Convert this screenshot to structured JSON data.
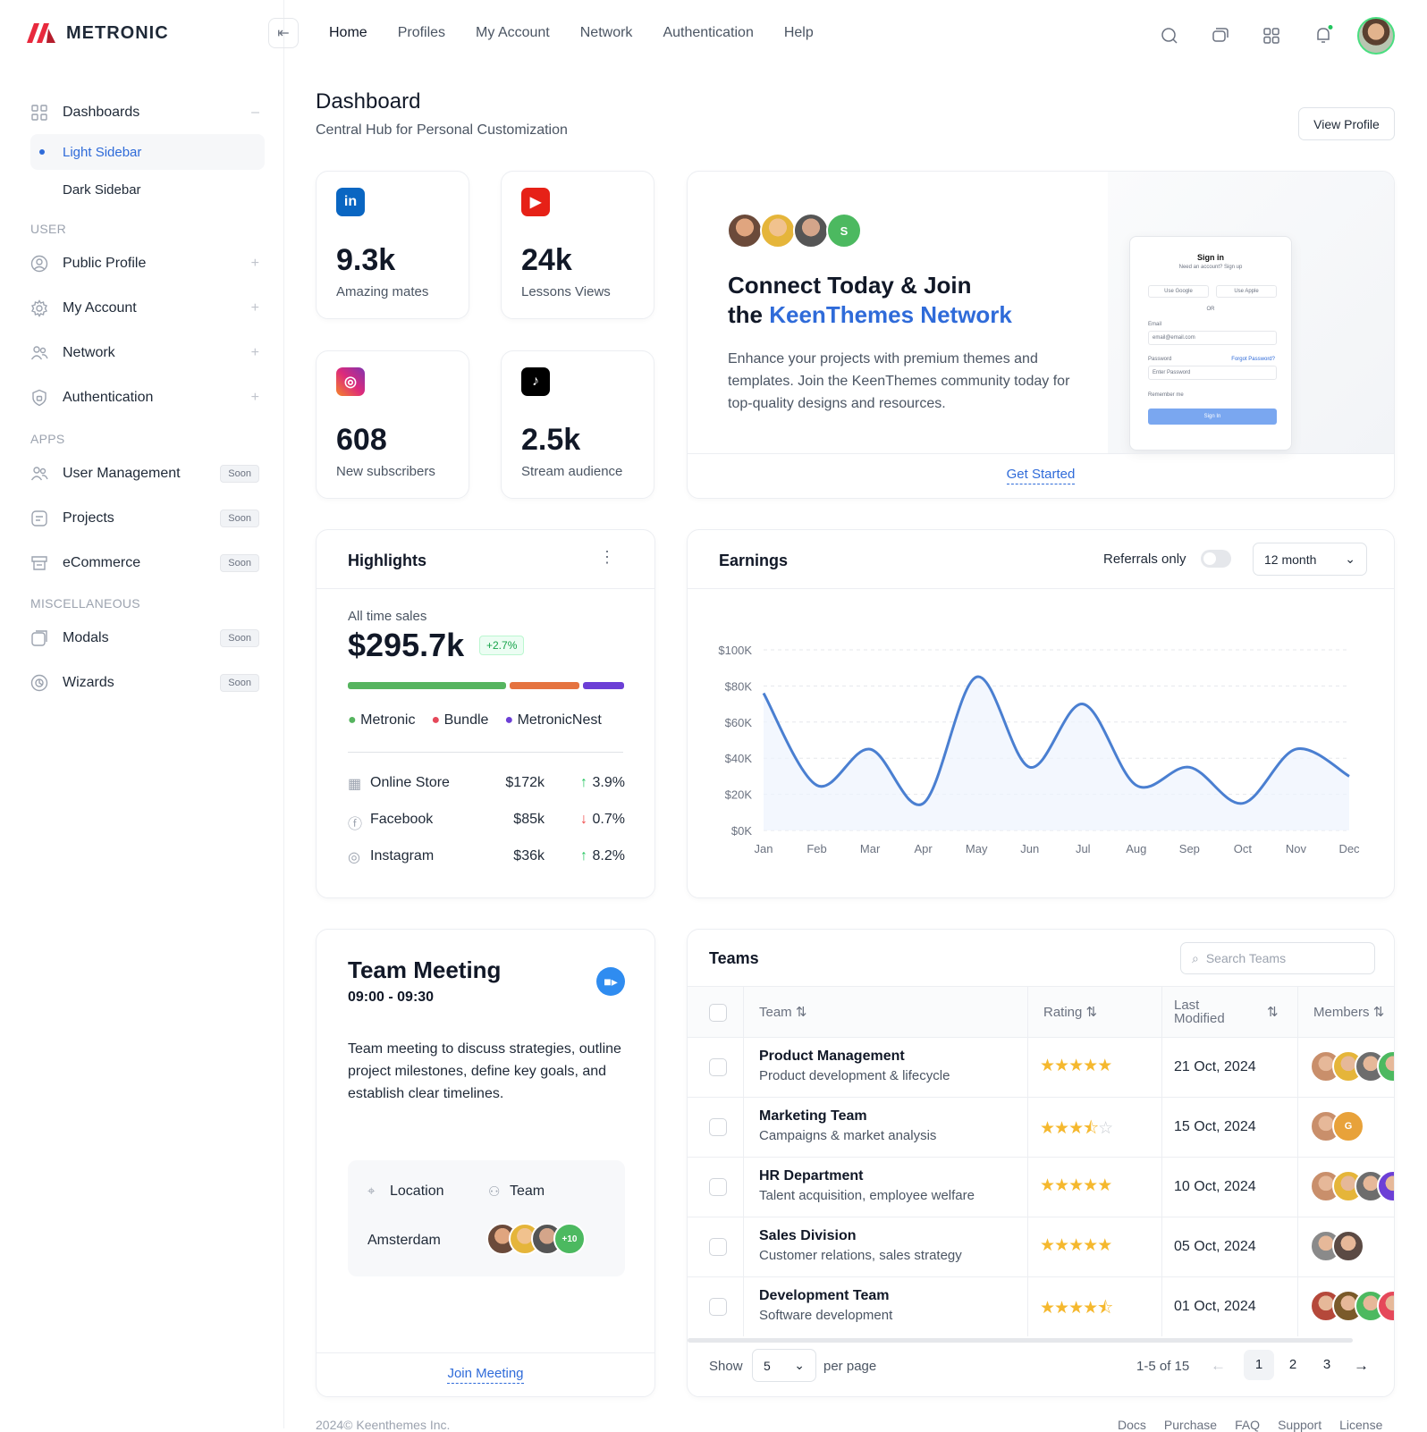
{
  "app": {
    "name": "METRONIC"
  },
  "topnav": [
    "Home",
    "Profiles",
    "My Account",
    "Network",
    "Authentication",
    "Help"
  ],
  "sidebar": {
    "dashboards": "Dashboards",
    "light_sidebar": "Light Sidebar",
    "dark_sidebar": "Dark Sidebar",
    "user_heading": "USER",
    "public_profile": "Public Profile",
    "my_account": "My Account",
    "network": "Network",
    "authentication": "Authentication",
    "apps_heading": "APPS",
    "user_management": "User Management",
    "projects": "Projects",
    "ecommerce": "eCommerce",
    "misc_heading": "MISCELLANEOUS",
    "modals": "Modals",
    "wizards": "Wizards",
    "soon": "Soon",
    "plus": "+",
    "minus": "–"
  },
  "header": {
    "title": "Dashboard",
    "subtitle": "Central Hub for Personal Customization",
    "view_profile": "View Profile"
  },
  "stats": [
    {
      "value": "9.3k",
      "label": "Amazing mates",
      "icon": "linkedin-icon",
      "color": "#0a66c2"
    },
    {
      "value": "24k",
      "label": "Lessons Views",
      "icon": "youtube-icon",
      "color": "#e62117"
    },
    {
      "value": "608",
      "label": "New subscribers",
      "icon": "instagram-icon",
      "color": "#c13584"
    },
    {
      "value": "2.5k",
      "label": "Stream audience",
      "icon": "tiktok-icon",
      "color": "#000000"
    }
  ],
  "connect": {
    "line1": "Connect Today & Join",
    "line2_prefix": "the",
    "line2_brand": "KeenThemes Network",
    "body": "Enhance your projects with premium themes and templates. Join the KeenThemes community today for top-quality designs and resources.",
    "cta": "Get Started",
    "avatar_letter": "S",
    "mock": {
      "title": "Sign in",
      "subtitle": "Need an account? Sign up",
      "google": "Use Google",
      "apple": "Use Apple",
      "or": "OR",
      "email": "Email",
      "email_ph": "email@email.com",
      "password": "Password",
      "forgot": "Forgot Password?",
      "password_ph": "Enter Password",
      "remember": "Remember me",
      "signin": "Sign In"
    }
  },
  "highlights": {
    "title": "Highlights",
    "all_time": "All time sales",
    "amount": "$295.7k",
    "badge": "+2.7%",
    "legend": [
      {
        "name": "Metronic",
        "color": "#56b45f"
      },
      {
        "name": "Bundle",
        "color": "#e57340"
      },
      {
        "name": "MetronicNest",
        "color": "#6c3fd6"
      }
    ],
    "rows": [
      {
        "name": "Online Store",
        "value": "$172k",
        "change": "3.9%",
        "dir": "up"
      },
      {
        "name": "Facebook",
        "value": "$85k",
        "change": "0.7%",
        "dir": "down"
      },
      {
        "name": "Instagram",
        "value": "$36k",
        "change": "8.2%",
        "dir": "up"
      }
    ]
  },
  "earnings": {
    "title": "Earnings",
    "referrals": "Referrals only",
    "period": "12 month"
  },
  "chart_data": {
    "type": "area",
    "categories": [
      "Jan",
      "Feb",
      "Mar",
      "Apr",
      "May",
      "Jun",
      "Jul",
      "Aug",
      "Sep",
      "Oct",
      "Nov",
      "Dec"
    ],
    "values": [
      76,
      25,
      45,
      15,
      85,
      35,
      70,
      25,
      35,
      15,
      45,
      30
    ],
    "y_ticks": [
      "$0K",
      "$20K",
      "$40K",
      "$60K",
      "$80K",
      "$100K"
    ],
    "ylim": [
      0,
      100
    ],
    "color": "#4a7fd1",
    "grid": true
  },
  "meeting": {
    "title": "Team Meeting",
    "time": "09:00 - 09:30",
    "desc1": "Team meeting to discuss strategies, outline",
    "desc2": "project milestones, define key goals, and establish clear timelines.",
    "location_label": "Location",
    "team_label": "Team",
    "location": "Amsterdam",
    "more": "+10",
    "join": "Join Meeting"
  },
  "teams": {
    "title": "Teams",
    "search_ph": "Search Teams",
    "columns": [
      "Team",
      "Rating",
      "Last Modified",
      "Members"
    ],
    "col_lm_1": "Last",
    "col_lm_2": "Modified",
    "rows": [
      {
        "name": "Product Management",
        "desc": "Product development & lifecycle",
        "rating": 5,
        "date": "21 Oct, 2024"
      },
      {
        "name": "Marketing Team",
        "desc": "Campaigns & market analysis",
        "rating": 3.5,
        "date": "15 Oct, 2024"
      },
      {
        "name": "HR Department",
        "desc": "Talent acquisition, employee welfare",
        "rating": 5,
        "date": "10 Oct, 2024"
      },
      {
        "name": "Sales Division",
        "desc": "Customer relations, sales strategy",
        "rating": 5,
        "date": "05 Oct, 2024"
      },
      {
        "name": "Development Team",
        "desc": "Software development",
        "rating": 4.5,
        "date": "01 Oct, 2024"
      }
    ],
    "member_letter": "G",
    "show": "Show",
    "per_page_value": "5",
    "per_page": "per page",
    "range": "1-5 of 15",
    "pages": [
      "1",
      "2",
      "3"
    ]
  },
  "footer": {
    "copyright": "2024© Keenthemes Inc.",
    "links": [
      "Docs",
      "Purchase",
      "FAQ",
      "Support",
      "License"
    ]
  }
}
